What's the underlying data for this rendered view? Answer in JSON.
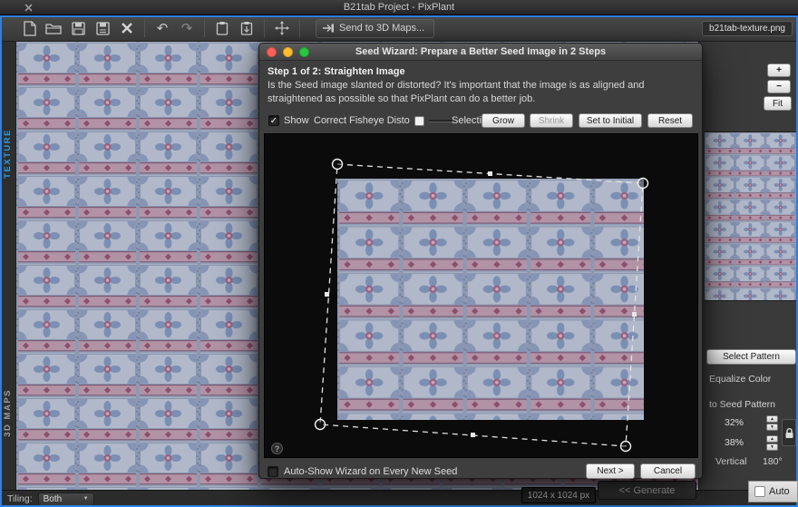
{
  "window": {
    "title": "B21tab Project - PixPlant"
  },
  "toolbar": {
    "send_to_3d_maps": "Send to 3D Maps...",
    "filename": "b21tab-texture.png",
    "undo_glyph": "↶",
    "redo_glyph": "↷"
  },
  "side_tabs": {
    "texture": "TEXTURE",
    "maps": "3D MAPS"
  },
  "right_panel": {
    "zoom_in": "+",
    "zoom_out": "−",
    "fit": "Fit",
    "select_pattern": "Select Pattern",
    "equalize_color": "Equalize Color",
    "to_seed_pattern": "to Seed Pattern",
    "percent_1": "32%",
    "percent_2": "38%",
    "vertical_label": "Vertical",
    "angle": "180°",
    "generate": "<< Generate",
    "auto_label": "Auto",
    "stepper_up": "▲",
    "stepper_down": "▼"
  },
  "status_bar": {
    "tiling_label": "Tiling:",
    "tiling_value": "Both",
    "dropdown_glyph": "▼",
    "canvas_size": "1024 x 1024 px"
  },
  "dialog": {
    "title": "Seed Wizard: Prepare a Better Seed Image in 2 Steps",
    "step_heading": "Step 1 of 2: Straighten Image",
    "description": "Is the Seed image slanted or distorted? It's important that the image is as aligned and straightened as possible so that PixPlant can do a better job.",
    "show_label": "Show",
    "show_check": "✓",
    "fisheye_label": "Correct Fisheye Disto",
    "selection_label": "Selection:",
    "grow": "Grow",
    "shrink": "Shrink",
    "set_to_initial": "Set to Initial",
    "reset": "Reset",
    "help_glyph": "?",
    "autoshow_label": "Auto-Show Wizard on Every New Seed",
    "next": "Next >",
    "cancel": "Cancel"
  }
}
